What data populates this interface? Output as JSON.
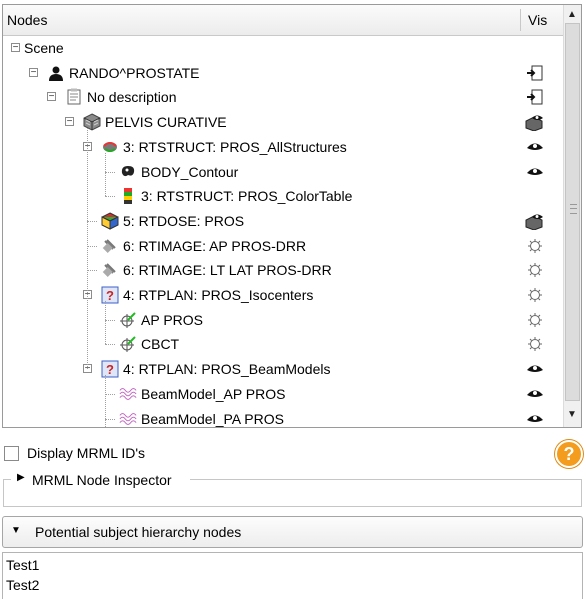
{
  "header": {
    "nodes_label": "Nodes",
    "vis_label": "Vis"
  },
  "tree": [
    {
      "label": "Scene",
      "icon": "scene",
      "expander": "minus",
      "vis": "none"
    },
    {
      "label": "RANDO^PROSTATE",
      "icon": "patient-icon",
      "expander": "minus",
      "vis": "eye-toggle-icon"
    },
    {
      "label": "No description",
      "icon": "study-icon",
      "expander": "minus",
      "vis": "eye-toggle-icon"
    },
    {
      "label": "PELVIS CURATIVE",
      "icon": "ct-volume-icon",
      "expander": "minus",
      "vis": "volume-visibility-icon"
    },
    {
      "label": "3: RTSTRUCT: PROS_AllStructures",
      "icon": "segmentation-icon",
      "expander": "minus",
      "vis": "eye-icon"
    },
    {
      "label": "BODY_Contour",
      "icon": "contour-icon",
      "expander": "none",
      "vis": "eye-icon"
    },
    {
      "label": "3: RTSTRUCT: PROS_ColorTable",
      "icon": "color-table-icon",
      "expander": "none",
      "vis": "none"
    },
    {
      "label": "5: RTDOSE: PROS",
      "icon": "dose-volume-icon",
      "expander": "none",
      "vis": "volume-visibility-icon"
    },
    {
      "label": "6: RTIMAGE: AP PROS-DRR",
      "icon": "rt-image-icon",
      "expander": "none",
      "vis": "hidden-eye-icon"
    },
    {
      "label": "6: RTIMAGE: LT LAT PROS-DRR",
      "icon": "rt-image-icon",
      "expander": "none",
      "vis": "hidden-eye-icon"
    },
    {
      "label": "4: RTPLAN: PROS_Isocenters",
      "icon": "rt-plan-icon",
      "expander": "minus",
      "vis": "hidden-eye-icon"
    },
    {
      "label": "AP PROS",
      "icon": "beam-icon",
      "expander": "none",
      "vis": "hidden-eye-icon"
    },
    {
      "label": "CBCT",
      "icon": "beam-icon",
      "expander": "none",
      "vis": "hidden-eye-icon"
    },
    {
      "label": "4: RTPLAN: PROS_BeamModels",
      "icon": "rt-plan-icon",
      "expander": "minus",
      "vis": "eye-icon"
    },
    {
      "label": "BeamModel_AP PROS",
      "icon": "beam-model-icon",
      "expander": "none",
      "vis": "eye-icon"
    },
    {
      "label": "BeamModel_PA PROS",
      "icon": "beam-model-icon",
      "expander": "none",
      "vis": "eye-icon"
    }
  ],
  "display_mrml_ids": {
    "label": "Display MRML ID's",
    "checked": false
  },
  "help": {
    "glyph": "?"
  },
  "inspector": {
    "title": "MRML Node Inspector",
    "arrow": "▶"
  },
  "potential": {
    "label": "Potential subject hierarchy nodes",
    "arrow": "▼"
  },
  "potential_list": [
    "Test1",
    "Test2"
  ],
  "scrollbar": {
    "up": "▲",
    "down": "▼"
  },
  "colors": {
    "help_orange": "#f39c1e",
    "beam_purple": "#c060c0",
    "plan_blue": "#3c5fc9"
  }
}
